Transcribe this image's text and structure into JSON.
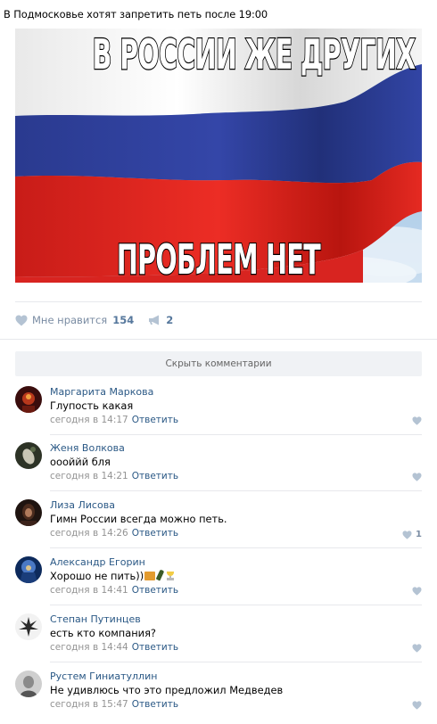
{
  "post": {
    "text": "В Подмосковье хотят запретить петь после 19:00",
    "image": {
      "caption_top": "В РОССИИ ЖЕ ДРУГИХ",
      "caption_bottom": "ПРОБЛЕМ НЕТ",
      "flag_colors": {
        "white": "#f4f4f4",
        "blue": "#2b3c9c",
        "red": "#e0261f",
        "sky": "#9fc3e3"
      }
    }
  },
  "actions": {
    "like_label": "Мне нравится",
    "like_count": "154",
    "share_count": "2",
    "icon_color": "#b4c3d3"
  },
  "comments_toggle": "Скрыть комментарии",
  "reply_label": "Ответить",
  "comments": [
    {
      "author": "Маргарита Маркова",
      "text": "Глупость какая",
      "time": "сегодня в 14:17",
      "likes": ""
    },
    {
      "author": "Женя Волкова",
      "text": "оооййй бля",
      "time": "сегодня в 14:21",
      "likes": ""
    },
    {
      "author": "Лиза Лисова",
      "text": "Гимн России всегда можно петь.",
      "time": "сегодня в 14:26",
      "likes": "1"
    },
    {
      "author": "Александр Егорин",
      "text": "Хорошо не пить))",
      "time": "сегодня в 14:41",
      "likes": ""
    },
    {
      "author": "Степан Путинцев",
      "text": "есть кто компания?",
      "time": "сегодня в 14:44",
      "likes": ""
    },
    {
      "author": "Рустем Гиниатуллин",
      "text": "Не удивлюсь что это предложил Медведев",
      "time": "сегодня в 15:47",
      "likes": ""
    }
  ],
  "colors": {
    "link": "#2a5885",
    "meta": "#939393",
    "accent": "#55779c"
  }
}
